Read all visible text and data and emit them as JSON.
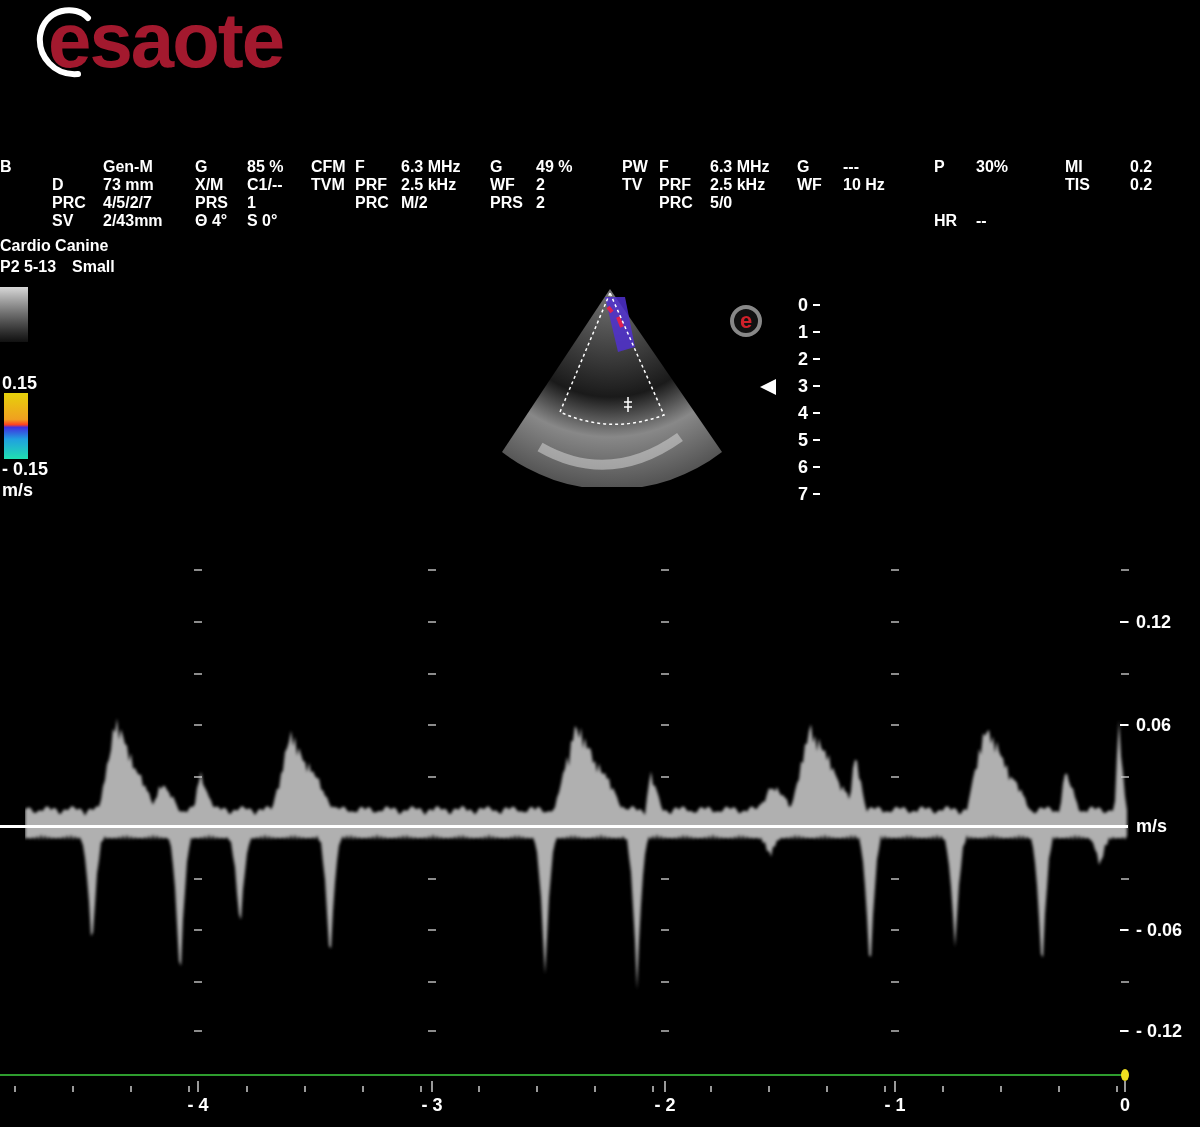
{
  "logo": {
    "mark": "e",
    "text": "saote"
  },
  "params": {
    "rows": [
      {
        "column_1": "B",
        "column_3": "Gen-M",
        "column_4": "G",
        "column_5": "85 %",
        "column_6": "CFM",
        "column_7": "F",
        "column_8": "6.3 MHz",
        "column_9": "G",
        "column_10": "49 %",
        "column_11": "PW",
        "column_12": "F",
        "column_13": "6.3 MHz",
        "column_14": "G",
        "column_15": "---",
        "column_16": "P",
        "column_17": "30%",
        "column_18": "MI",
        "column_19": "0.2"
      },
      {
        "column_2": "D",
        "column_3": "73 mm",
        "column_4": "X/M",
        "column_5": "C1/--",
        "column_6": "TVM",
        "column_7": "PRF",
        "column_8": "2.5 kHz",
        "column_9": "WF",
        "column_10": "2",
        "column_11": "TV",
        "column_12": "PRF",
        "column_13": "2.5 kHz",
        "column_14": "WF",
        "column_15": "10 Hz",
        "column_18": "TIS",
        "column_19": "0.2"
      },
      {
        "column_2": "PRC",
        "column_3": "4/5/2/7",
        "column_4": "PRS",
        "column_5": "1",
        "column_7": "PRC",
        "column_8": "M/2",
        "column_9": "PRS",
        "column_10": "2",
        "column_12": "PRC",
        "column_13": "5/0"
      },
      {
        "column_2": "SV",
        "column_3": "2/43mm",
        "column_4": "Θ 4°",
        "column_5": "S 0°",
        "column_16": "HR",
        "column_17": "--"
      }
    ]
  },
  "preset": {
    "name": "Cardio Canine",
    "probe": "P2 5-13",
    "size": "Small"
  },
  "color_map": {
    "max": "0.15",
    "min": "- 0.15",
    "unit": "m/s"
  },
  "sector_mark": "e",
  "depth_scale": [
    "0",
    "1",
    "2",
    "3",
    "4",
    "5",
    "6",
    "7"
  ],
  "doppler": {
    "y_labels": [
      "0.12",
      "0.06",
      "m/s",
      "- 0.06",
      "- 0.12"
    ],
    "x_labels": [
      "- 4",
      "- 3",
      "- 2",
      "- 1",
      "0"
    ]
  }
}
